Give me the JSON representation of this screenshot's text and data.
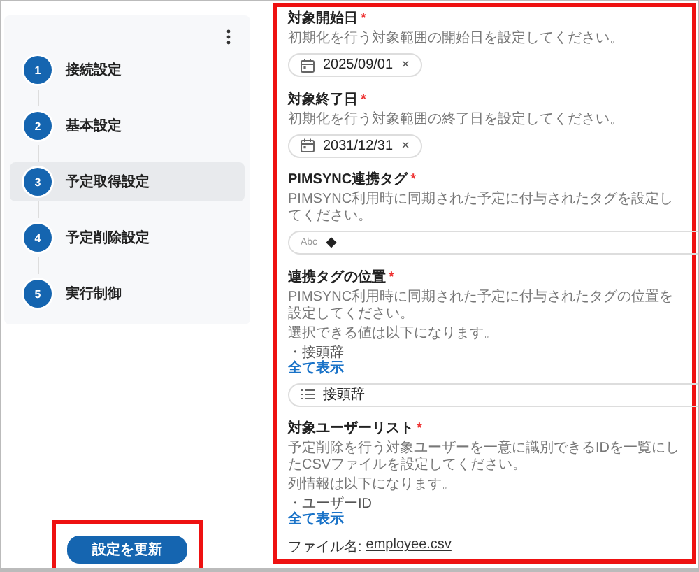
{
  "sidebar": {
    "steps": [
      {
        "number": "1",
        "label": "接続設定",
        "selected": false
      },
      {
        "number": "2",
        "label": "基本設定",
        "selected": false
      },
      {
        "number": "3",
        "label": "予定取得設定",
        "selected": true
      },
      {
        "number": "4",
        "label": "予定削除設定",
        "selected": false
      },
      {
        "number": "5",
        "label": "実行制御",
        "selected": false
      }
    ]
  },
  "update_button": {
    "label": "設定を更新",
    "highlighted": true
  },
  "form": {
    "highlighted": true,
    "sections": [
      {
        "title": "対象開始日",
        "required_mark": "*",
        "descriptions": [
          "初期化を行う対象範囲の開始日を設定してください。"
        ],
        "field": {
          "kind": "date",
          "value": "2025/09/01",
          "clear": "×"
        }
      },
      {
        "title": "対象終了日",
        "required_mark": "*",
        "descriptions": [
          "初期化を行う対象範囲の終了日を設定してください。"
        ],
        "field": {
          "kind": "date",
          "value": "2031/12/31",
          "clear": "×"
        }
      },
      {
        "title": "PIMSYNC連携タグ",
        "required_mark": "*",
        "descriptions": [
          "PIMSYNC利用時に同期された予定に付与されたタグを設定してください。"
        ],
        "field": {
          "kind": "text",
          "type_hint": "Abc",
          "value": "◆"
        }
      },
      {
        "title": "連携タグの位置",
        "required_mark": "*",
        "descriptions": [
          "PIMSYNC利用時に同期された予定に付与されたタグの位置を設定してください。",
          "選択できる値は以下になります。"
        ],
        "options": [
          "・接頭辞"
        ],
        "link": "全て表示",
        "field": {
          "kind": "select",
          "value": "接頭辞"
        }
      },
      {
        "title": "対象ユーザーリスト",
        "required_mark": "*",
        "descriptions": [
          "予定削除を行う対象ユーザーを一意に識別できるIDを一覧にしたCSVファイルを設定してください。",
          "列情報は以下になります。"
        ],
        "options": [
          "・ユーザーID"
        ],
        "link": "全て表示",
        "file": {
          "label": "ファイル名:",
          "name": "employee.csv"
        }
      }
    ]
  }
}
